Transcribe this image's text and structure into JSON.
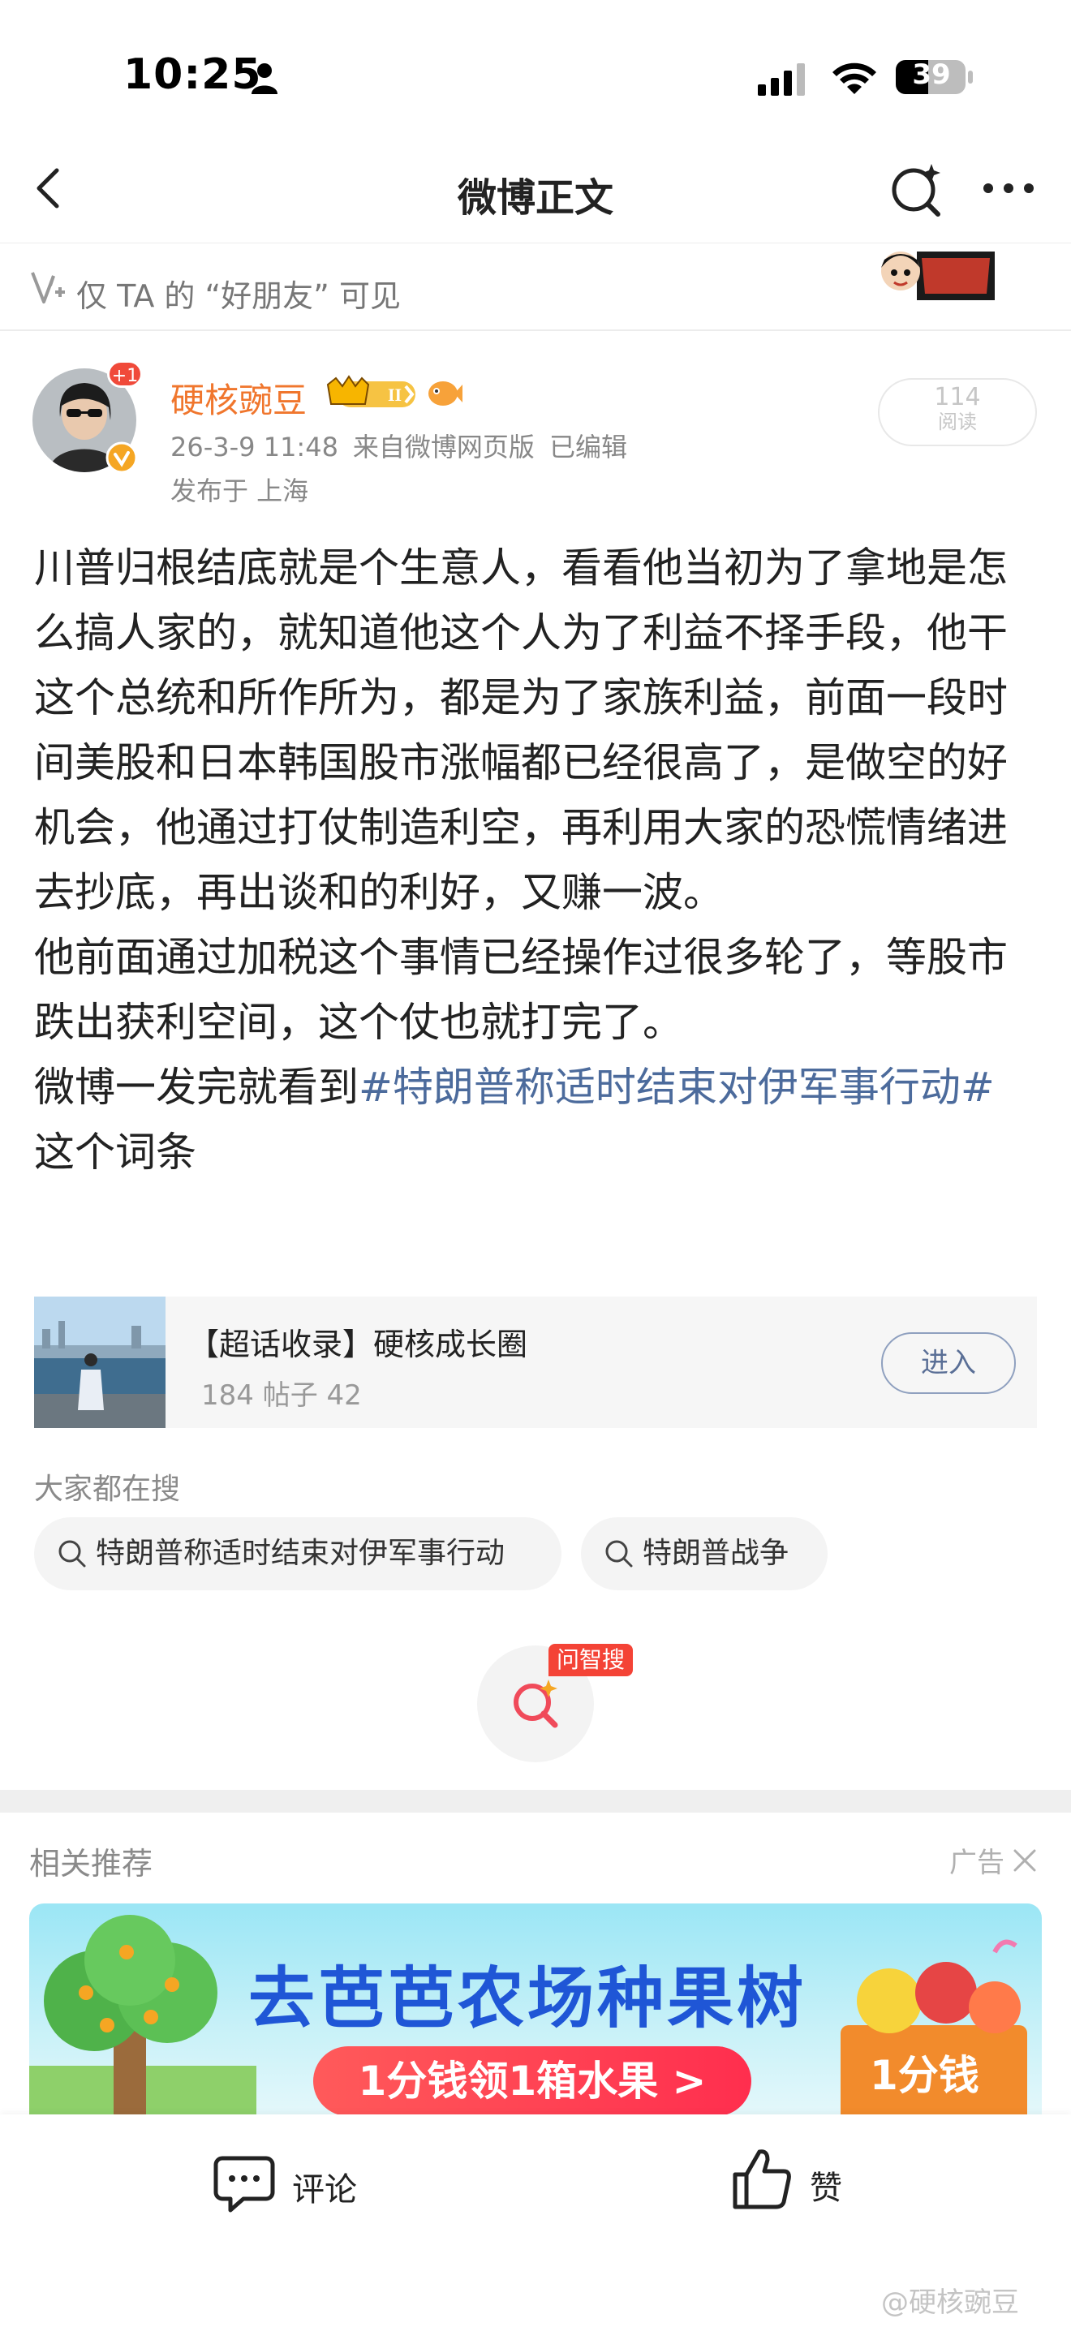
{
  "status_bar": {
    "time": "10:25",
    "battery": "39"
  },
  "nav": {
    "title": "微博正文"
  },
  "visibility": {
    "text": "仅 TA 的 “好朋友” 可见"
  },
  "author": {
    "name": "硬核豌豆",
    "plus_badge": "+1",
    "date": "26-3-9 11:48",
    "source": "来自微博网页版",
    "edited": "已编辑",
    "location": "发布于 上海",
    "reads_count": "114",
    "reads_label": "阅读"
  },
  "post": {
    "paragraph1": "川普归根结底就是个生意人，看看他当初为了拿地是怎么搞人家的，就知道他这个人为了利益不择手段，他干这个总统和所作所为，都是为了家族利益，前面一段时间美股和日本韩国股市涨幅都已经很高了，是做空的好机会，他通过打仗制造利空，再利用大家的恐慌情绪进去抄底，再出谈和的利好，又赚一波。",
    "paragraph2": "他前面通过加税这个事情已经操作过很多轮了，等股市跌出获利空间，这个仗也就打完了。",
    "paragraph3_prefix": "微博一发完就看到",
    "hashtag": "#特朗普称适时结束对伊军事行动#",
    "paragraph3_suffix": " 这个词条"
  },
  "card": {
    "title": "【超话收录】硬核成长圈",
    "subtitle": "184 帖子 42",
    "button": "进入"
  },
  "hot_search": {
    "label": "大家都在搜",
    "chips": [
      "特朗普称适时结束对伊军事行动",
      "特朗普战争"
    ]
  },
  "wenzhisou": {
    "tag": "问智搜"
  },
  "related": {
    "label": "相关推荐",
    "ad_label": "广告"
  },
  "banner": {
    "title": "去芭芭农场种果树",
    "pill": "1分钱领1箱水果 >",
    "price": "1分钱"
  },
  "bottom_bar": {
    "comment": "评论",
    "like": "赞",
    "watermark": "@硬核豌豆"
  },
  "colors": {
    "author_name": "#f0762d",
    "hashtag": "#4c6b9c",
    "banner_title": "#1f56d6",
    "tag_red": "#f44336"
  }
}
